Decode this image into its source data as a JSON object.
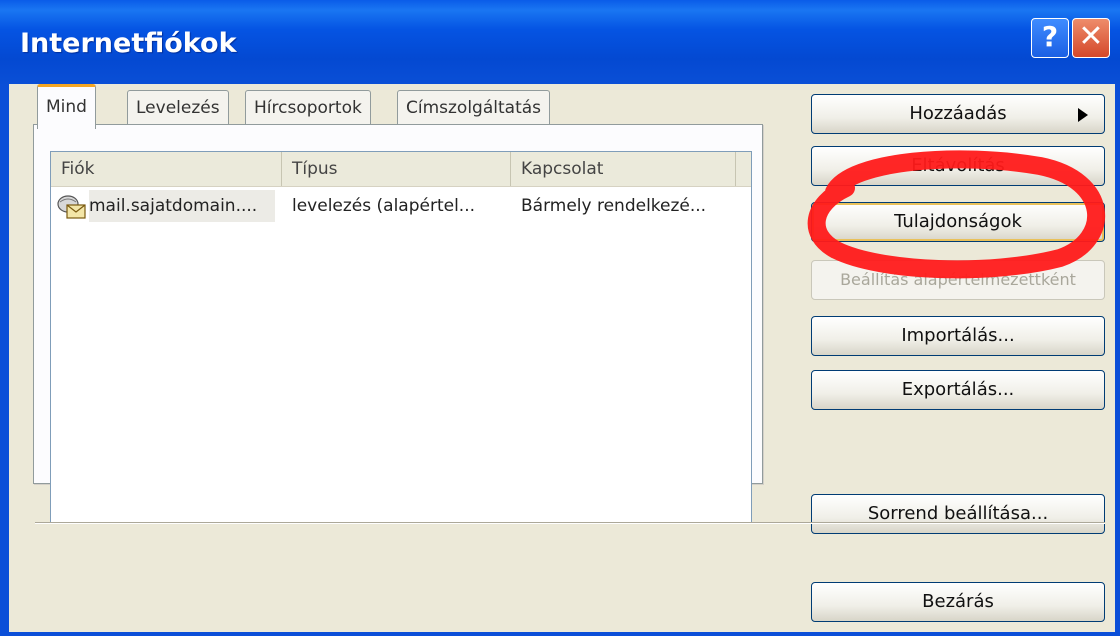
{
  "window": {
    "title": "Internetfiókok",
    "help_button": "?",
    "close_button": "✕"
  },
  "tabs": [
    {
      "label": "Mind",
      "active": true
    },
    {
      "label": "Levelezés",
      "active": false
    },
    {
      "label": "Hírcsoportok",
      "active": false
    },
    {
      "label": "Címszolgáltatás",
      "active": false
    }
  ],
  "list": {
    "columns": [
      "Fiók",
      "Típus",
      "Kapcsolat"
    ],
    "rows": [
      {
        "account": "mail.sajatdomain....",
        "type": "levelezés (alapértel...",
        "connection": "Bármely rendelkezé...",
        "icon": "mail-account-icon"
      }
    ]
  },
  "buttons": {
    "add": "Hozzáadás",
    "remove": "Eltávolítás",
    "properties": "Tulajdonságok",
    "set_default": "Beállítás alapértelmezettként",
    "import": "Importálás...",
    "export": "Exportálás...",
    "order": "Sorrend beállítása...",
    "close": "Bezárás"
  },
  "annotation": {
    "highlight_color": "#ff0000",
    "highlight_target": "properties-button"
  },
  "colors": {
    "titlebar": "#0554e3",
    "dialog_bg": "#ece9d8",
    "tab_accent": "#f5a623"
  }
}
